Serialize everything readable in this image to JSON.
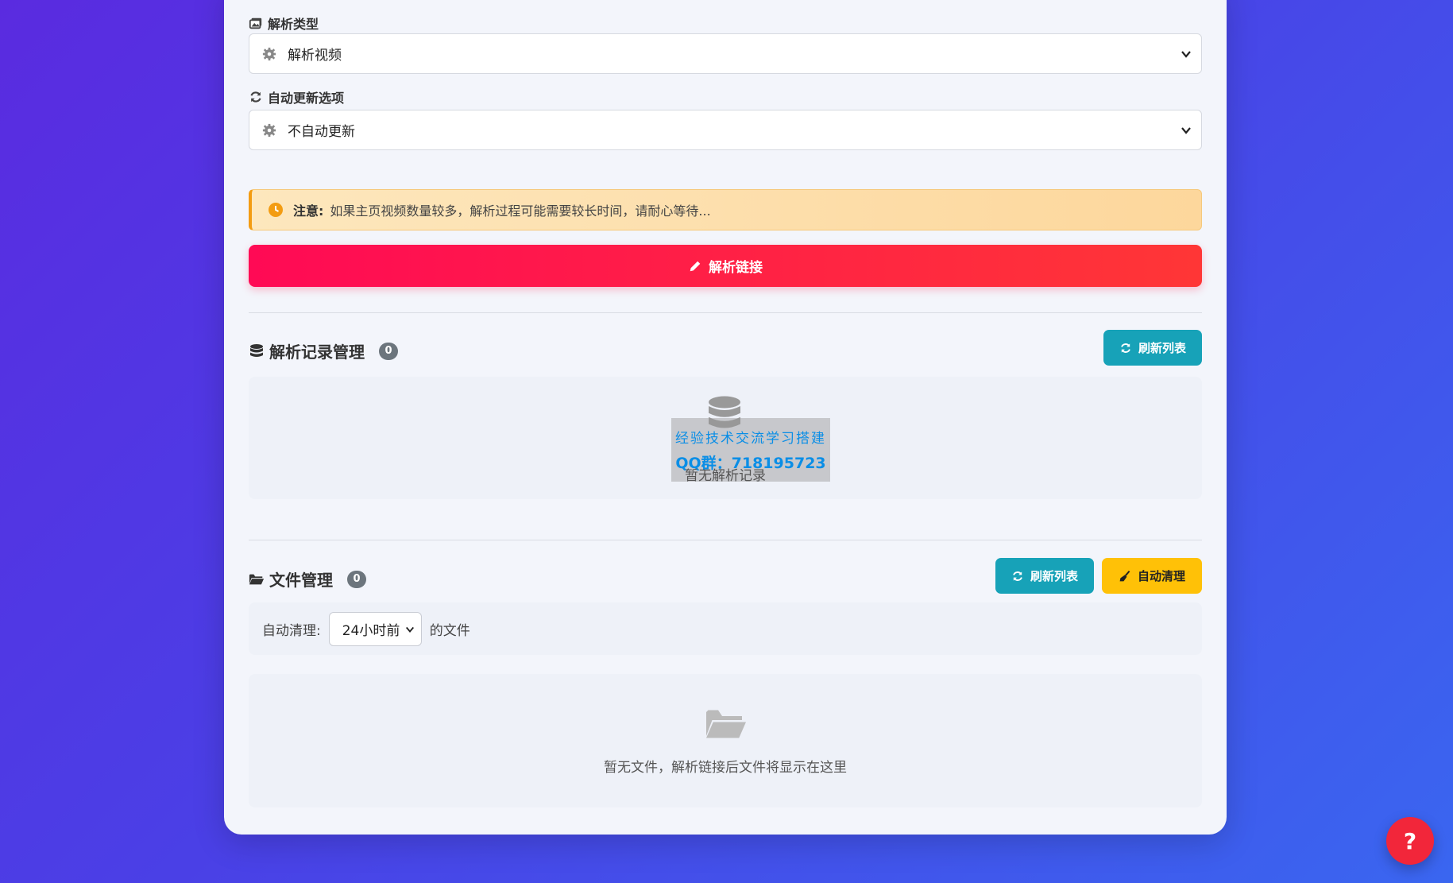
{
  "parse_type": {
    "label": "解析类型",
    "selected": "解析视频"
  },
  "auto_update": {
    "label": "自动更新选项",
    "selected": "不自动更新"
  },
  "notice": {
    "title": "注意:",
    "text": "如果主页视频数量较多，解析过程可能需要较长时间，请耐心等待..."
  },
  "parse_button": {
    "label": "解析链接"
  },
  "records": {
    "title": "解析记录管理",
    "count": "0",
    "refresh_label": "刷新列表",
    "empty_text": "暂无解析记录",
    "watermark_line1": "经验技术交流学习搭建",
    "watermark_line2": "QQ群：718195723"
  },
  "files": {
    "title": "文件管理",
    "count": "0",
    "refresh_label": "刷新列表",
    "auto_clean_label": "自动清理",
    "auto_clean_prefix": "自动清理:",
    "auto_clean_selected": "24小时前",
    "auto_clean_suffix": "的文件",
    "empty_text": "暂无文件，解析链接后文件将显示在这里"
  },
  "help": {
    "label": "?"
  },
  "colors": {
    "accent_red": "#ff1f4b",
    "teal": "#17a2b8",
    "yellow": "#ffc107",
    "warning_border": "#f39c12"
  }
}
